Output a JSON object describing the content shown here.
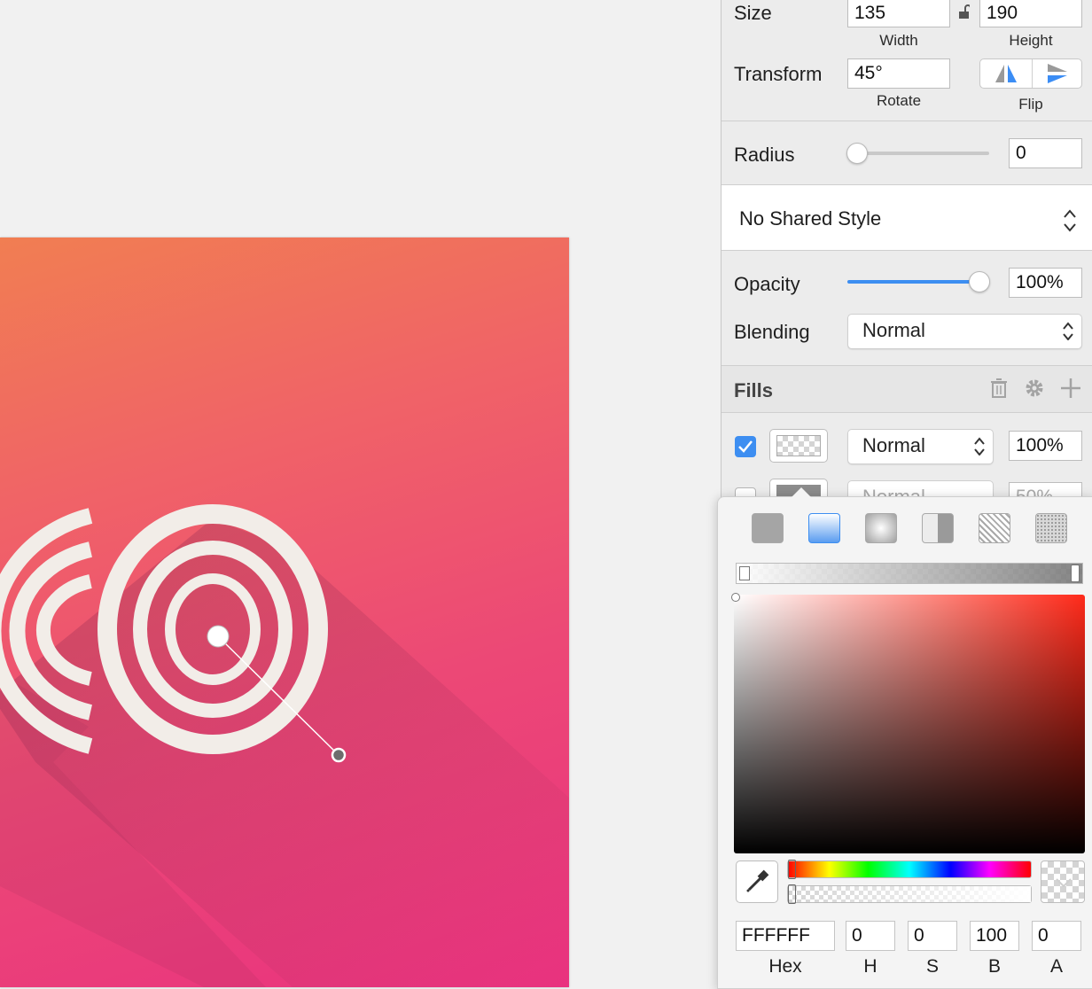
{
  "inspector": {
    "size": {
      "label": "Size",
      "width_value": "135",
      "height_value": "190",
      "width_label": "Width",
      "height_label": "Height"
    },
    "transform": {
      "label": "Transform",
      "rotate_value": "45°",
      "rotate_label": "Rotate",
      "flip_label": "Flip"
    },
    "radius": {
      "label": "Radius",
      "value": "0",
      "slider_fraction": 0.0
    },
    "shared_style": {
      "value": "No Shared Style"
    },
    "opacity": {
      "label": "Opacity",
      "value": "100%",
      "slider_fraction": 1.0
    },
    "blending": {
      "label": "Blending",
      "value": "Normal"
    },
    "fills": {
      "title": "Fills",
      "icons": [
        "trash-icon",
        "gear-icon",
        "plus-icon"
      ],
      "rows": [
        {
          "checked": true,
          "blend": "Normal",
          "opacity": "100%"
        },
        {
          "checked": false,
          "blend": "Normal",
          "opacity": "50%"
        }
      ]
    }
  },
  "color_picker": {
    "fill_types": [
      "flat-color",
      "linear-gradient",
      "radial-gradient",
      "angular-gradient",
      "pattern-fill",
      "noise-fill"
    ],
    "selected_fill_type": "linear-gradient",
    "hex": "FFFFFF",
    "h": "0",
    "s": "0",
    "b": "100",
    "a": "0",
    "labels": {
      "hex": "Hex",
      "h": "H",
      "s": "S",
      "b": "B",
      "a": "A"
    },
    "hue_color": "#ff2a1a"
  },
  "canvas": {
    "gradient_start": "#f17e52",
    "gradient_end": "#e9327f",
    "logo_color": "#f2ede8"
  }
}
